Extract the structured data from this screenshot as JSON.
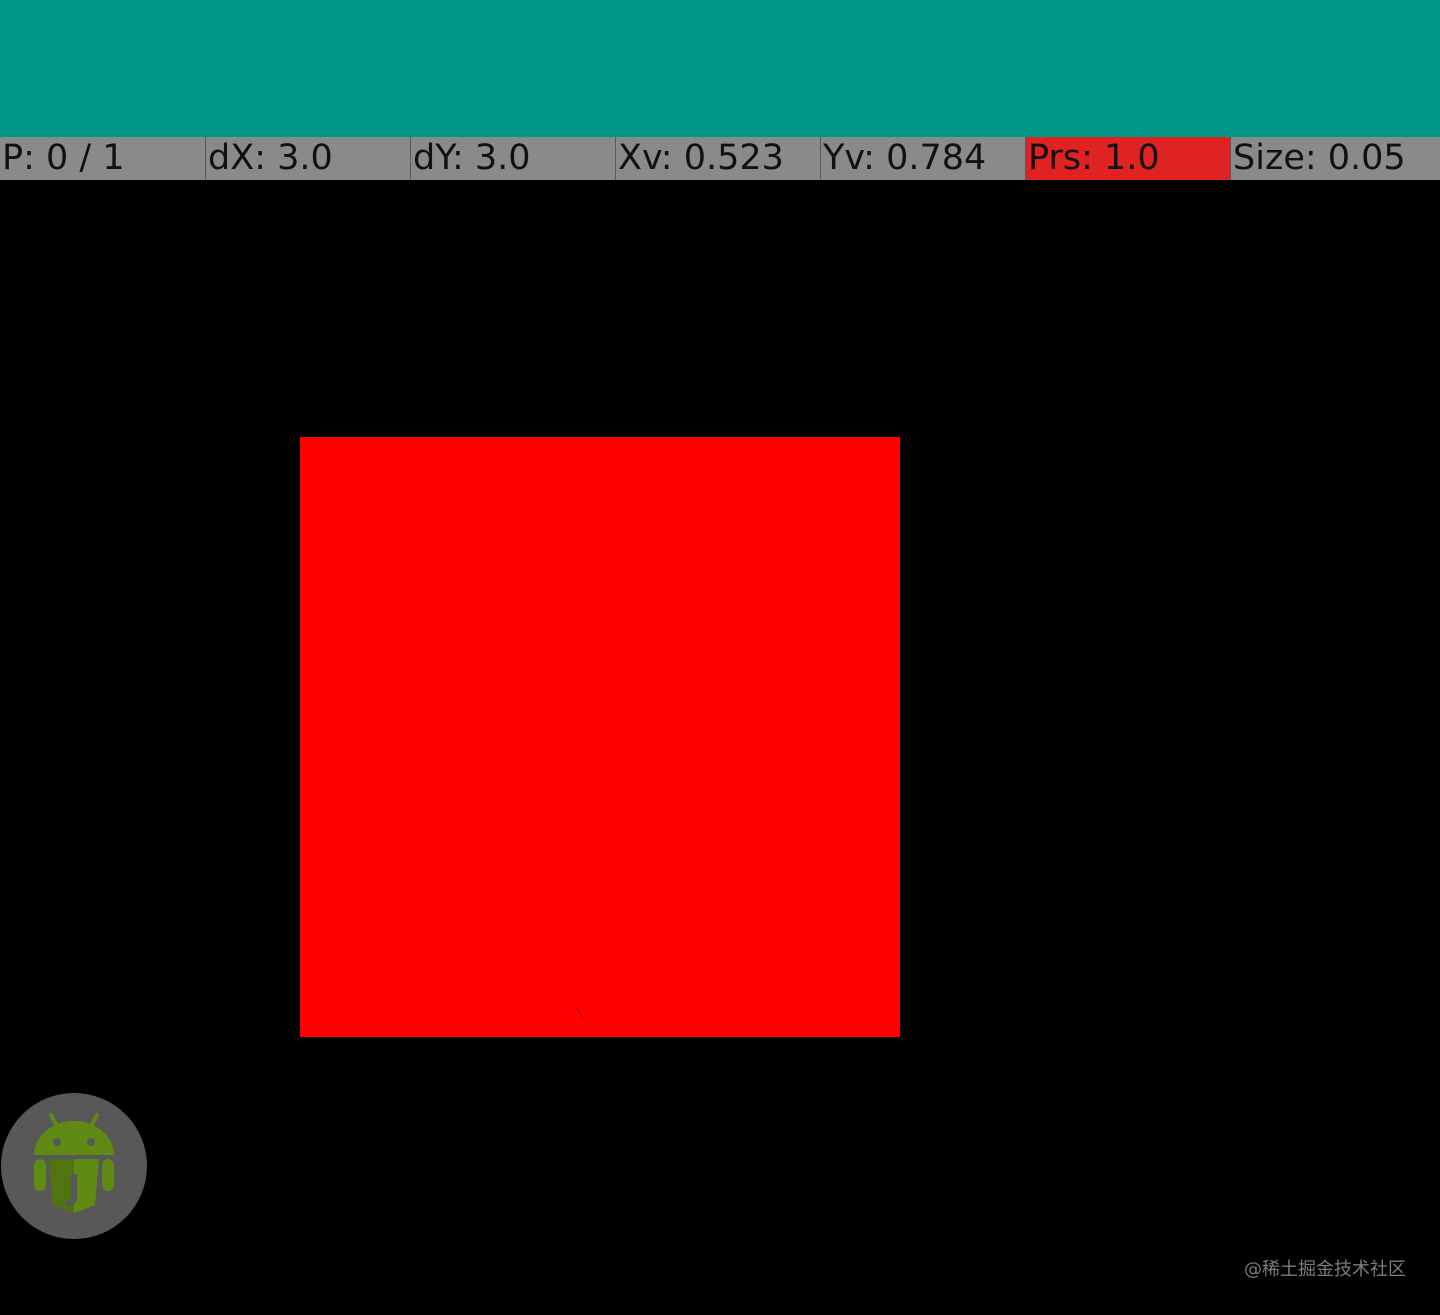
{
  "pointer_location": {
    "pointers": "P: 0 / 1",
    "dx": "dX: 3.0",
    "dy": "dY: 3.0",
    "xv": "Xv: 0.523",
    "yv": "Yv: 0.784",
    "pressure": "Prs: 1.0",
    "size": "Size: 0.05"
  },
  "colors": {
    "app_bar": "#009688",
    "status_bar_bg": "#8a8a8a",
    "pressure_highlight": "#e02222",
    "square": "#ff0000",
    "background": "#000000"
  },
  "floating_button": {
    "icon": "android-j-icon",
    "letter": "J"
  },
  "watermark": "@稀土掘金技术社区"
}
